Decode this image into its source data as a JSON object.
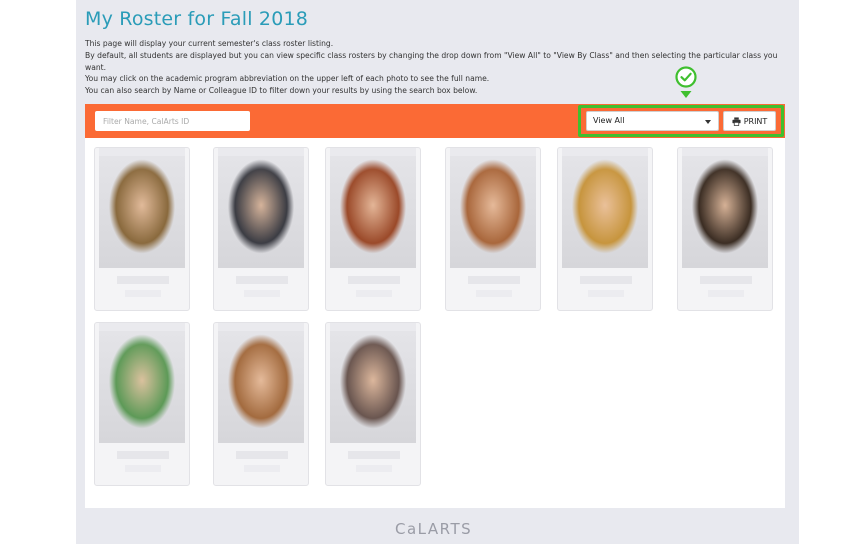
{
  "page": {
    "title": "My Roster for Fall 2018",
    "intro_lines": [
      "This page will display your current semester's class roster listing.",
      "By default, all students are displayed but you can view specific class rosters by changing the drop down from \"View All\" to \"View By Class\" and then selecting the particular class you want.",
      "You may click on the academic program abbreviation on the upper left of each photo to see the full name.",
      "You can also search by Name or Colleague ID to filter down your results by using the search box below."
    ]
  },
  "toolbar": {
    "search_placeholder": "Filter Name, CalArts ID",
    "view_select_value": "View All",
    "print_label": "PRINT",
    "accent_color": "#fb6a35",
    "highlight_color": "#3fbf2f"
  },
  "roster": {
    "photo_count": 9,
    "photo_tones": [
      "#8a6a3e",
      "#3c3d44",
      "#9b4a2a",
      "#a9673c",
      "#c7953e",
      "#3c2e24",
      "#5e9a58",
      "#a36b3f",
      "#6a5650"
    ]
  },
  "footer": {
    "logo_text": "CaLARTS"
  }
}
